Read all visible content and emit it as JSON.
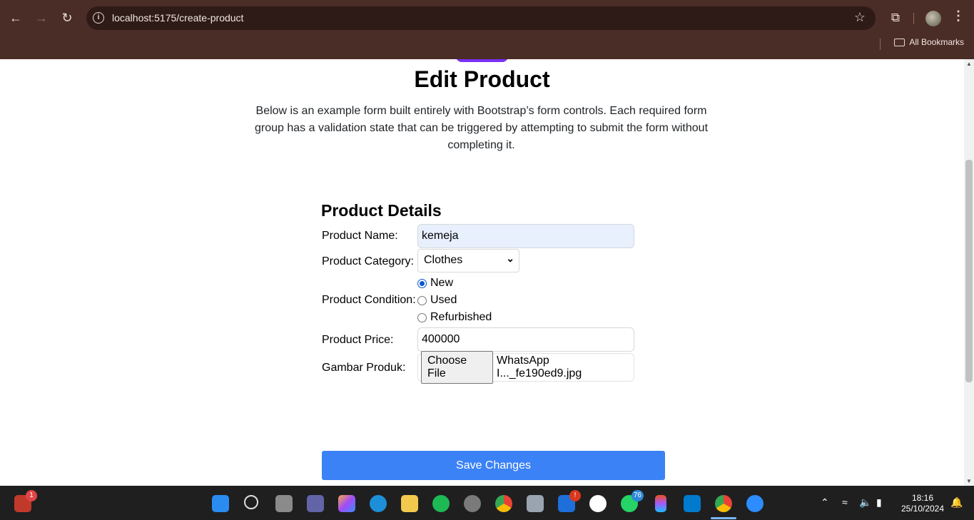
{
  "browser": {
    "url": "localhost:5175/create-product",
    "bookmarks_label": "All Bookmarks"
  },
  "page": {
    "title": "Edit Product",
    "description": "Below is an example form built entirely with Bootstrap’s form controls. Each required form group has a validation state that can be triggered by attempting to submit the form without completing it.",
    "section_title": "Product Details",
    "fields": {
      "name_label": "Product Name:",
      "name_value": "kemeja",
      "category_label": "Product Category:",
      "category_value": "Clothes",
      "condition_label": "Product Condition:",
      "condition_options": [
        "New",
        "Used",
        "Refurbished"
      ],
      "condition_selected": "New",
      "price_label": "Product Price:",
      "price_value": "400000",
      "image_label": "Gambar Produk:",
      "file_button": "Choose File",
      "file_name": "WhatsApp I..._fe190ed9.jpg"
    },
    "save_button": "Save Changes"
  },
  "taskbar": {
    "left_badge": "1",
    "mail_badge": "!",
    "whatsapp_badge": "76",
    "time": "18:16",
    "date": "25/10/2024"
  }
}
